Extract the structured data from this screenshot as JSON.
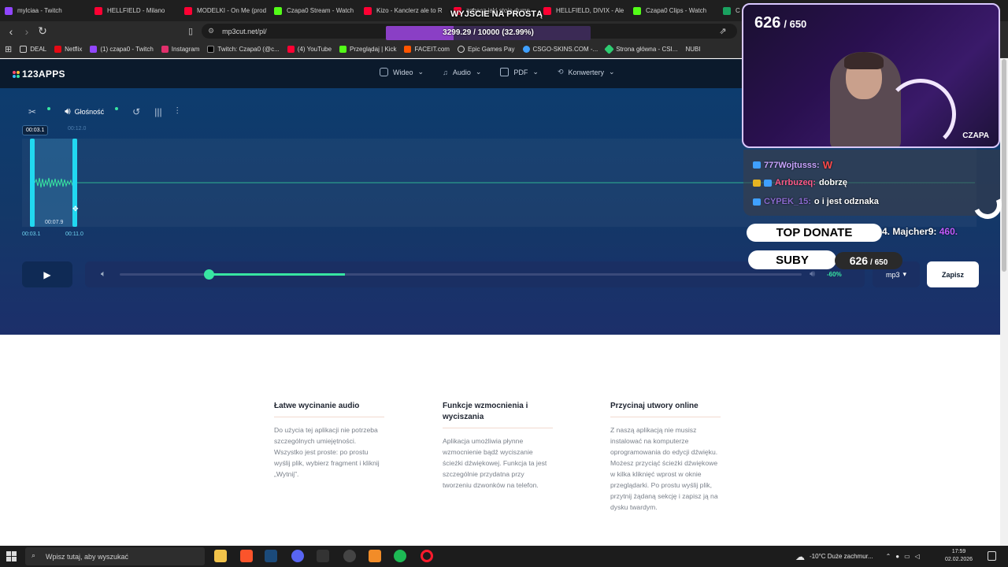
{
  "browser": {
    "tabs": [
      {
        "label": "mylciaa - Twitch",
        "color": "#9146ff"
      },
      {
        "label": "HELLFIELD - Milano",
        "color": "#ff0033"
      },
      {
        "label": "MODELKI - On Me (prod",
        "color": "#ff0033"
      },
      {
        "label": "Czapa0 Stream - Watch",
        "color": "#53fc18"
      },
      {
        "label": "Kizo - Kanclerz ale to R",
        "color": "#ff0033"
      },
      {
        "label": "zobacz jaki stoję dumn",
        "color": "#ff0033"
      },
      {
        "label": "HELLFIELD, DIVIX - Ale",
        "color": "#ff0033"
      },
      {
        "label": "Czapa0 Clips - Watch",
        "color": "#53fc18"
      },
      {
        "label": "C",
        "color": "#1aa260"
      }
    ],
    "url": "mp3cut.net/pl/",
    "bookmarks": [
      {
        "label": "DEAL",
        "color": "#cfcfcf"
      },
      {
        "label": "Netflix",
        "color": "#e50914"
      },
      {
        "label": "(1) czapa0 - Twitch",
        "color": "#9146ff"
      },
      {
        "label": "Instagram",
        "color": "#e1306c"
      },
      {
        "label": "Twitch: Czapa0 (@c...",
        "color": "#000000"
      },
      {
        "label": "(4) YouTube",
        "color": "#ff0033"
      },
      {
        "label": "Przeglądaj | Kick",
        "color": "#53fc18"
      },
      {
        "label": "FACEIT.com",
        "color": "#ff5500"
      },
      {
        "label": "Epic Games Pay",
        "color": "#dcdcdc"
      },
      {
        "label": "CSGO-SKINS.COM -...",
        "color": "#3fa0ff"
      },
      {
        "label": "Strona główna - CSI...",
        "color": "#2ecc71"
      },
      {
        "label": "NUBI",
        "color": "#cfcfcf"
      }
    ]
  },
  "app": {
    "logo": "123APPS",
    "nav": [
      "Wideo",
      "Audio",
      "PDF",
      "Konwertery"
    ],
    "tools": {
      "volume_label": "Głośność"
    },
    "selection": {
      "bubble_time": "00:03.1",
      "end_time_top": "00:12.0",
      "start_time": "00:03.1",
      "end_time": "00:11.0",
      "duration": "00:07.9"
    },
    "volume_percent": "-60%",
    "volume_knob_fraction": 0.13,
    "format": "mp3",
    "save_label": "Zapisz"
  },
  "features": [
    {
      "title": "Łatwe wycinanie audio",
      "body": "Do użycia tej aplikacji nie potrzeba szczególnych umiejętności. Wszystko jest proste: po prostu wyślij plik, wybierz fragment i kliknij „Wytnij”."
    },
    {
      "title": "Funkcje wzmocnienia i wyciszania",
      "body": "Aplikacja umożliwia płynne wzmocnienie bądź wyciszanie ścieżki dźwiękowej. Funkcja ta jest szczególnie przydatna przy tworzeniu dzwonków na telefon."
    },
    {
      "title": "Przycinaj utwory online",
      "body": "Z naszą aplikacją nie musisz instalować na komputerze oprogramowania do edycji dźwięku. Możesz przyciąć ścieżki dźwiękowe w kilka kliknięć wprost w oknie przeglądarki. Po prostu wyślij plik, przytnij żądaną sekcję i zapisz ją na dysku twardym."
    }
  ],
  "overlay": {
    "title": "WYJŚCIE NA PROSTĄ",
    "goal_text": "3299.29 / 10000 (32.99%)",
    "goal_fraction": 0.3299,
    "cam_subs": "626",
    "cam_subs_max": "/ 650",
    "cam_name": "CZAPA",
    "chat": [
      {
        "user": "777Wojtusss:",
        "msg": "W",
        "user_color": "#c8a4ff",
        "msg_color": "#ff4a4a"
      },
      {
        "user": "Arrbuzeq:",
        "msg": "dobrzę",
        "user_color": "#ff5a8a",
        "msg_color": "#ffffff"
      },
      {
        "user": "CYPEK_15:",
        "msg": "o i jest odznaka",
        "user_color": "#8a6acf",
        "msg_color": "#ffffff"
      }
    ],
    "top_donate_label": "TOP DONATE",
    "top_donate_user": "4. Majcher9:",
    "top_donate_amount": "460.",
    "subs_label": "SUBY",
    "subs_count": "626",
    "subs_max": "/ 650"
  },
  "taskbar": {
    "search_placeholder": "Wpisz tutaj, aby wyszukać",
    "weather": "-10°C  Duże zachmur...",
    "time": "17:59",
    "date": "02.02.2026"
  }
}
